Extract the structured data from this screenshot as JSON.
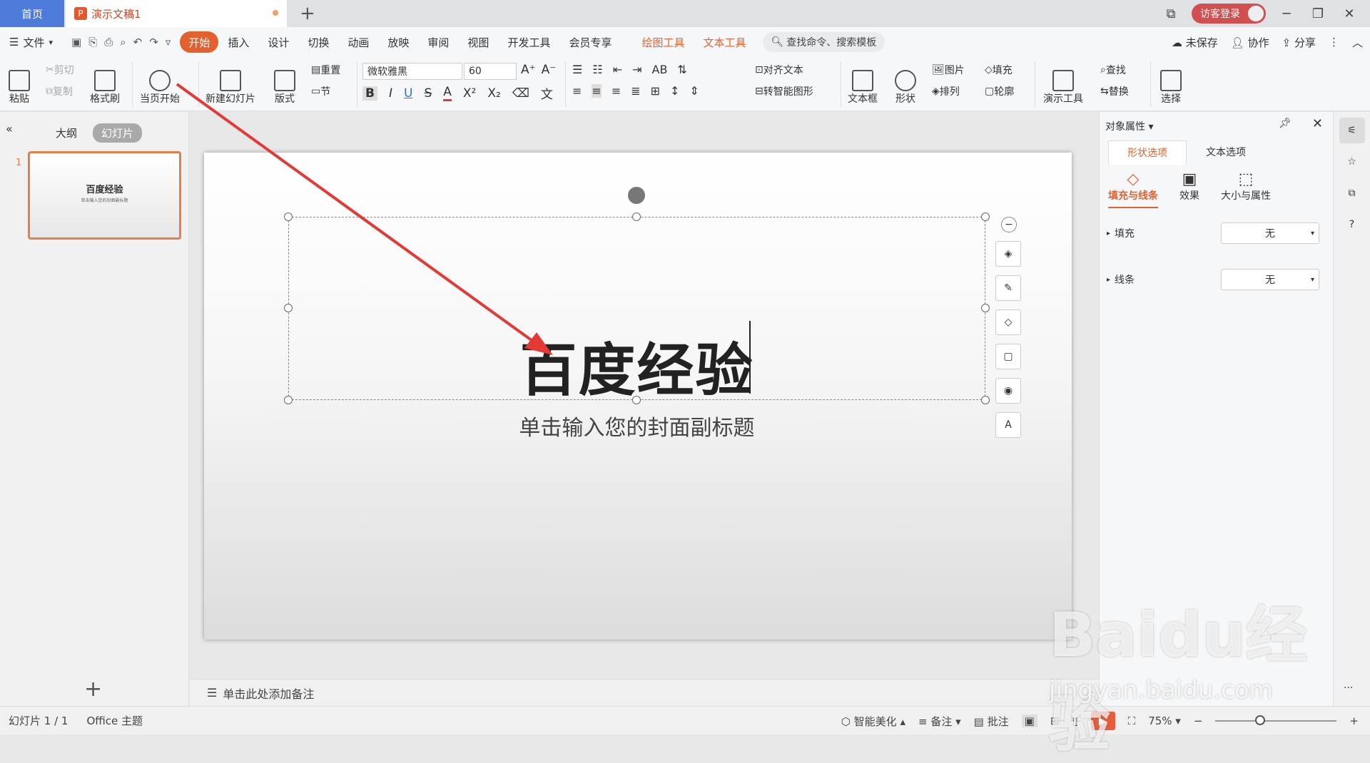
{
  "tabs": {
    "home": "首页",
    "doc": "演示文稿1",
    "new": "+"
  },
  "window": {
    "login": "访客登录",
    "minimize": "─",
    "maximize": "❐",
    "close": "✕"
  },
  "menu": {
    "file": "文件",
    "items": [
      "开始",
      "插入",
      "设计",
      "切换",
      "动画",
      "放映",
      "审阅",
      "视图",
      "开发工具",
      "会员专享"
    ],
    "tools": [
      "绘图工具",
      "文本工具"
    ],
    "search": "查找命令、搜索模板",
    "right": [
      "未保存",
      "协作",
      "分享"
    ]
  },
  "ribbon": {
    "paste": "粘贴",
    "cut": "剪切",
    "copy": "复制",
    "format_painter": "格式刷",
    "play_from": "当页开始",
    "new_slide": "新建幻灯片",
    "layout": "版式",
    "reset": "重置",
    "section": "节",
    "font": "微软雅黑",
    "font_size": "60",
    "align_text": "对齐文本",
    "smart_art": "转智能图形",
    "textbox": "文本框",
    "shape": "形状",
    "picture": "图片",
    "arrange": "排列",
    "fill": "填充",
    "outline": "轮廓",
    "present_tools": "演示工具",
    "find": "查找",
    "replace": "替换",
    "select": "选择"
  },
  "left_panel": {
    "outline_tab": "大纲",
    "slides_tab": "幻灯片",
    "slide_number": "1",
    "add": "+"
  },
  "slide": {
    "title": "百度经验",
    "subtitle": "单击输入您的封面副标题"
  },
  "notes": {
    "placeholder": "单击此处添加备注"
  },
  "props": {
    "title": "对象属性",
    "tabs": [
      "形状选项",
      "文本选项"
    ],
    "subtabs": [
      "填充与线条",
      "效果",
      "大小与属性"
    ],
    "fill_label": "填充",
    "fill_value": "无",
    "line_label": "线条",
    "line_value": "无"
  },
  "status": {
    "slide_info": "幻灯片 1 / 1",
    "theme": "Office 主题",
    "beautify": "智能美化",
    "notes": "备注",
    "comments": "批注",
    "zoom": "75%"
  },
  "watermark": {
    "text": "Baidu经验",
    "sub": "jingyan.baidu.com"
  },
  "colors": {
    "accent": "#e2612e",
    "home_tab": "#4e7ad9",
    "arrow": "#e53935"
  }
}
